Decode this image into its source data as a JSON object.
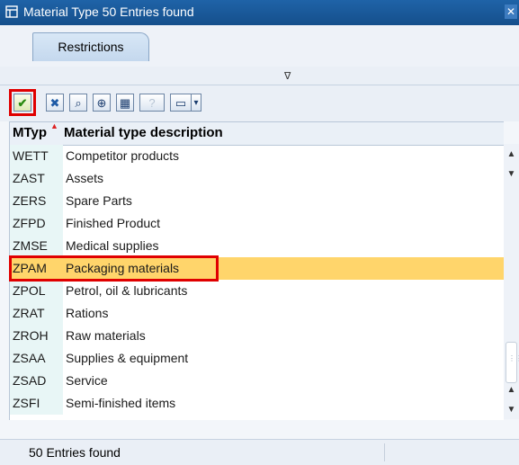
{
  "window": {
    "title": "Material Type   50 Entries found",
    "close_glyph": "✕"
  },
  "tabs": [
    {
      "label": "Restrictions"
    }
  ],
  "filter_toggle_glyph": "∇",
  "toolbar": [
    {
      "name": "confirm-button",
      "icon": "checkmark-icon",
      "glyph": "✔"
    },
    {
      "name": "cancel-button",
      "icon": "cancel-icon",
      "glyph": "✖"
    },
    {
      "name": "find-button",
      "icon": "binoculars-icon",
      "glyph": "⌕"
    },
    {
      "name": "find-next-button",
      "icon": "binoculars-plus-icon",
      "glyph": "⊕"
    },
    {
      "name": "select-button",
      "icon": "grid-icon",
      "glyph": "▦"
    },
    {
      "name": "help-button",
      "icon": "help-icon",
      "glyph": "?"
    },
    {
      "name": "print-button",
      "icon": "printer-icon",
      "glyph": "▭"
    },
    {
      "name": "more-button",
      "icon": "chevron-down-icon",
      "glyph": "▾"
    }
  ],
  "table": {
    "headers": [
      "MTyp",
      "Material type description"
    ],
    "sort_indicator": "▲",
    "rows": [
      {
        "key": "WETT",
        "desc": "Competitor products"
      },
      {
        "key": "ZAST",
        "desc": "Assets"
      },
      {
        "key": "ZERS",
        "desc": "Spare Parts"
      },
      {
        "key": "ZFPD",
        "desc": "Finished Product"
      },
      {
        "key": "ZMSE",
        "desc": "Medical supplies"
      },
      {
        "key": "ZPAM",
        "desc": "Packaging materials",
        "selected": true
      },
      {
        "key": "ZPOL",
        "desc": "Petrol, oil & lubricants"
      },
      {
        "key": "ZRAT",
        "desc": "Rations"
      },
      {
        "key": "ZROH",
        "desc": "Raw materials"
      },
      {
        "key": "ZSAA",
        "desc": "Supplies & equipment"
      },
      {
        "key": "ZSAD",
        "desc": "Service"
      },
      {
        "key": "ZSFI",
        "desc": "Semi-finished items"
      }
    ]
  },
  "scrollbar": {
    "up_glyph": "▲",
    "down_glyph": "▼",
    "grip_glyph": "⋮⋮"
  },
  "status_bar": {
    "text": "50 Entries found"
  },
  "colors": {
    "title_bar": "#1a5aa0",
    "selected_row": "#ffd56b",
    "highlight_box": "#e00000",
    "key_column": "#e8f6f6"
  }
}
